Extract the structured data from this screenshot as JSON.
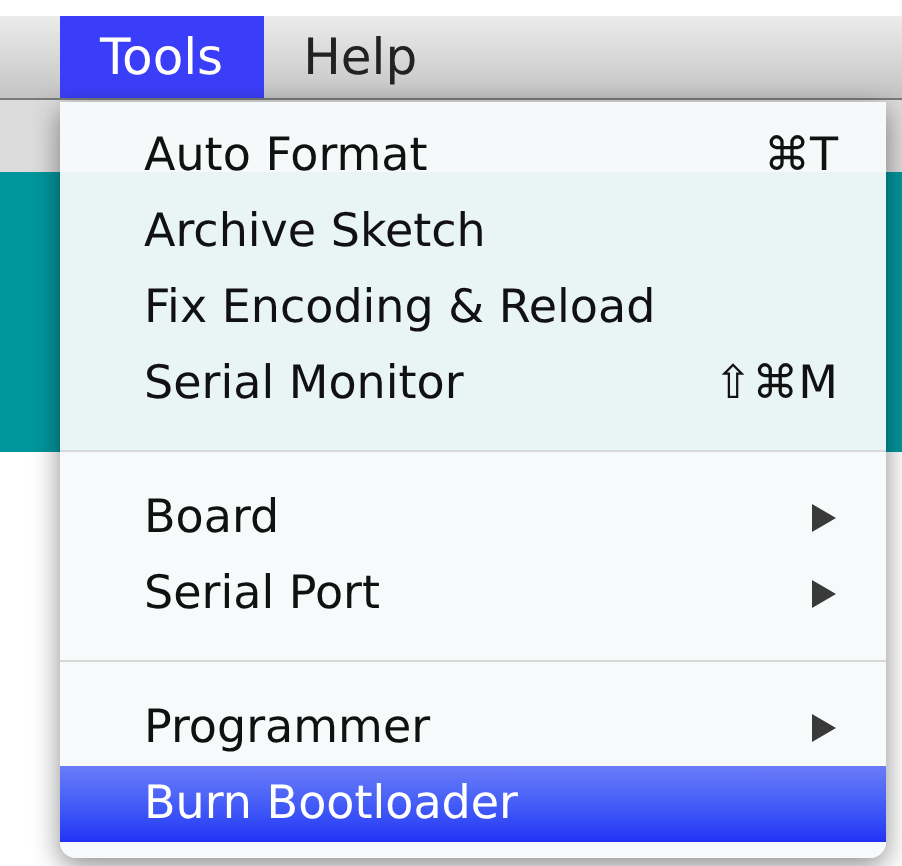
{
  "menu_bar": [
    {
      "label": "Tools",
      "selected": true
    },
    {
      "label": "Help",
      "selected": false
    }
  ],
  "menu": {
    "items": [
      {
        "kind": "item",
        "label": "Auto Format",
        "shortcut": "⌘T",
        "selected": false
      },
      {
        "kind": "item",
        "label": "Archive Sketch",
        "selected": false
      },
      {
        "kind": "item",
        "label": "Fix Encoding & Reload",
        "selected": false
      },
      {
        "kind": "item",
        "label": "Serial Monitor",
        "shortcut": "⇧⌘M",
        "selected": false
      },
      {
        "kind": "separator"
      },
      {
        "kind": "submenu",
        "label": "Board",
        "selected": false
      },
      {
        "kind": "submenu",
        "label": "Serial Port",
        "selected": false
      },
      {
        "kind": "separator"
      },
      {
        "kind": "submenu",
        "label": "Programmer",
        "selected": false
      },
      {
        "kind": "item",
        "label": "Burn Bootloader",
        "selected": true
      }
    ]
  }
}
